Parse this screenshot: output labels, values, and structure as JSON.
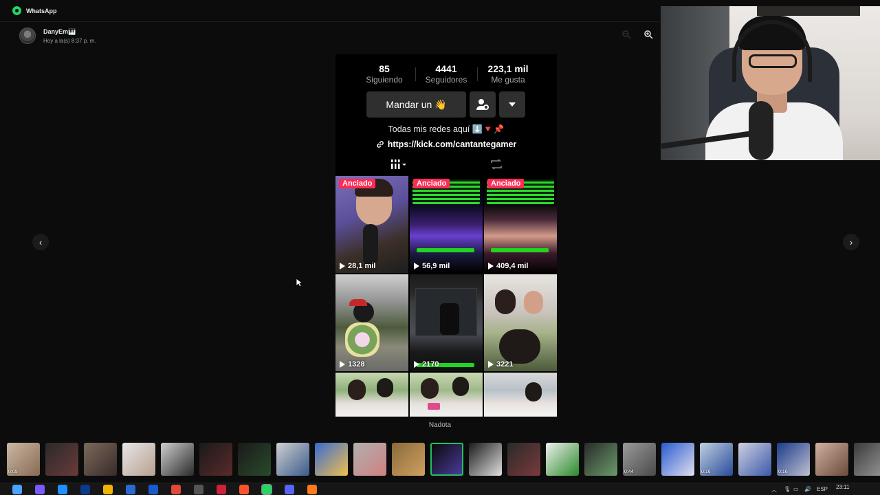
{
  "app": {
    "title": "WhatsApp",
    "icon": "whatsapp-icon",
    "accent": "#25d366"
  },
  "header": {
    "sender_name": "DanyEm🎹",
    "timestamp": "Hoy a la(s) 8:37 p. m."
  },
  "profile": {
    "stats": [
      {
        "value": "85",
        "label": "Siguiendo"
      },
      {
        "value": "4441",
        "label": "Seguidores"
      },
      {
        "value": "223,1 mil",
        "label": "Me gusta"
      }
    ],
    "message_button": "Mandar un 👋",
    "bio": "Todas mis redes aquí ⬇️🔻📌",
    "link": "https://kick.com/cantantegamer",
    "pinned_label": "Anciado",
    "videos": [
      {
        "views": "28,1 mil",
        "pinned": true
      },
      {
        "views": "56,9 mil",
        "pinned": true
      },
      {
        "views": "409,4 mil",
        "pinned": true
      },
      {
        "views": "1328",
        "pinned": false
      },
      {
        "views": "2170",
        "pinned": false
      },
      {
        "views": "3221",
        "pinned": false
      },
      {
        "views": "",
        "pinned": false
      },
      {
        "views": "",
        "pinned": false
      },
      {
        "views": "",
        "pinned": false
      }
    ],
    "badge_color": "#fe2c55"
  },
  "caption": "Nadota",
  "thumbnails": [
    {
      "time": "0:05"
    },
    {
      "time": ""
    },
    {
      "time": ""
    },
    {
      "time": ""
    },
    {
      "time": ""
    },
    {
      "time": ""
    },
    {
      "time": ""
    },
    {
      "time": ""
    },
    {
      "time": ""
    },
    {
      "time": ""
    },
    {
      "time": ""
    },
    {
      "time": "",
      "active": true
    },
    {
      "time": ""
    },
    {
      "time": ""
    },
    {
      "time": ""
    },
    {
      "time": ""
    },
    {
      "time": "0:44"
    },
    {
      "time": ""
    },
    {
      "time": "0:16"
    },
    {
      "time": ""
    },
    {
      "time": "0:16"
    },
    {
      "time": ""
    },
    {
      "time": ""
    }
  ],
  "taskbar": {
    "language": "ESP",
    "time": "23:11",
    "apps": [
      "windows-start-icon",
      "copilot-icon",
      "edge-icon",
      "photoshop-icon",
      "file-explorer-icon",
      "store-icon",
      "outlook-icon",
      "calendar-icon",
      "obs-icon",
      "opera-gx-icon",
      "brave-icon",
      "whatsapp-icon",
      "discord-icon",
      "app-icon"
    ]
  }
}
